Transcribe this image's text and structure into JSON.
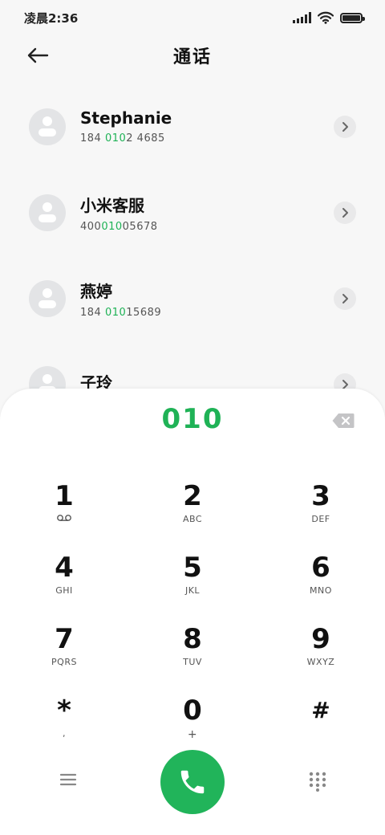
{
  "status_bar": {
    "time": "凌晨2:36",
    "icons": [
      "signal-icon",
      "wifi-icon",
      "battery-icon"
    ]
  },
  "header": {
    "title": "通话",
    "back_icon": "arrow-left-icon"
  },
  "contacts": [
    {
      "name": "Stephanie",
      "number_pre": "184 ",
      "number_match": "010",
      "number_post": "2 4685"
    },
    {
      "name": "小米客服",
      "number_pre": "400",
      "number_match": "010",
      "number_post": "05678"
    },
    {
      "name": "燕婷",
      "number_pre": "184 ",
      "number_match": "010",
      "number_post": "15689"
    },
    {
      "name": "子玲",
      "number_pre": "",
      "number_match": "",
      "number_post": ""
    }
  ],
  "dialer": {
    "input_value": "010",
    "keys": [
      {
        "digit": "1",
        "letters": ""
      },
      {
        "digit": "2",
        "letters": "ABC"
      },
      {
        "digit": "3",
        "letters": "DEF"
      },
      {
        "digit": "4",
        "letters": "GHI"
      },
      {
        "digit": "5",
        "letters": "JKL"
      },
      {
        "digit": "6",
        "letters": "MNO"
      },
      {
        "digit": "7",
        "letters": "PQRS"
      },
      {
        "digit": "8",
        "letters": "TUV"
      },
      {
        "digit": "9",
        "letters": "WXYZ"
      },
      {
        "digit": "*",
        "letters": ","
      },
      {
        "digit": "0",
        "letters": "+"
      },
      {
        "digit": "#",
        "letters": ""
      }
    ],
    "key1_icon": "voicemail-icon"
  },
  "colors": {
    "accent": "#1fb256",
    "call_button": "#21b45a",
    "background": "#f7f7f7",
    "sheet": "#ffffff"
  }
}
